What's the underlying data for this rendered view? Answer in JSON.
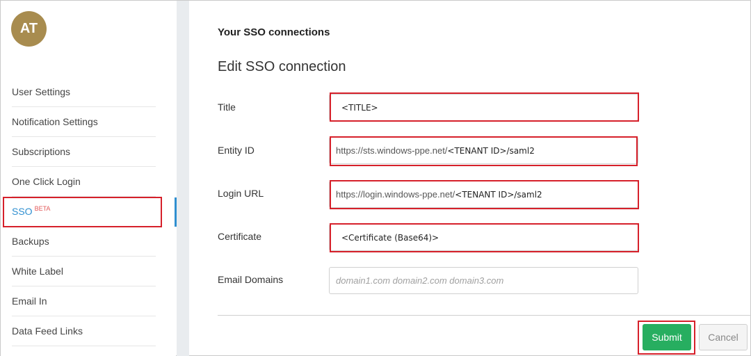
{
  "sidebar": {
    "avatar_initials": "AT",
    "items": [
      {
        "label": "User Settings"
      },
      {
        "label": "Notification Settings"
      },
      {
        "label": "Subscriptions"
      },
      {
        "label": "One Click Login"
      },
      {
        "label": "SSO",
        "badge": "BETA"
      },
      {
        "label": "Backups"
      },
      {
        "label": "White Label"
      },
      {
        "label": "Email In"
      },
      {
        "label": "Data Feed Links"
      }
    ]
  },
  "main": {
    "section_title": "Your SSO connections",
    "form_title": "Edit SSO connection",
    "fields": {
      "title": {
        "label": "Title",
        "value": "<TITLE>"
      },
      "entity_id": {
        "label": "Entity ID",
        "prefix": "https://sts.windows-ppe.net/",
        "value": "<TENANT ID>/saml2"
      },
      "login_url": {
        "label": "Login URL",
        "prefix": "https://login.windows-ppe.net/",
        "value": "<TENANT ID>/saml2"
      },
      "certificate": {
        "label": "Certificate",
        "value": "<Certificate (Base64)>"
      },
      "email_domains": {
        "label": "Email Domains",
        "placeholder": "domain1.com domain2.com domain3.com"
      }
    },
    "submit_label": "Submit",
    "cancel_label": "Cancel"
  },
  "colors": {
    "highlight": "#d6202a",
    "accent": "#2f8fd0",
    "submit": "#27ae60",
    "avatar": "#a88c4f"
  }
}
